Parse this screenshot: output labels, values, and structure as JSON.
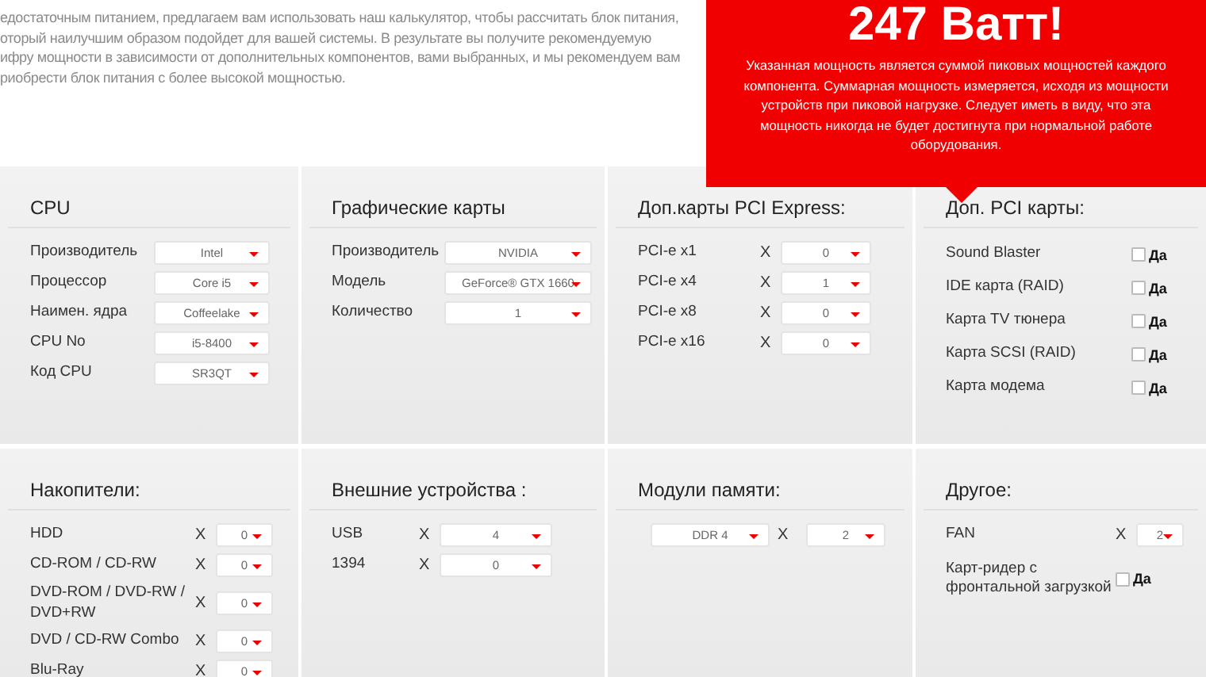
{
  "intro": {
    "lines": [
      "едостаточным питанием, предлагаем вам использовать наш калькулятор, чтобы рассчитать блок питания,",
      "оторый наилучшим образом подойдет для вашей системы. В результате вы получите рекомендуемую",
      "ифру мощности в зависимости от дополнительных компонентов, вами выбранных, и мы рекомендуем вам",
      "риобрести блок питания с более высокой мощностью."
    ]
  },
  "result": {
    "title": "247 Ватт!",
    "text": "Указанная мощность является суммой пиковых мощностей каждого компонента. Суммарная мощность измеряется, исходя из мощности устройств при пиковой нагрузке. Следует иметь в виду, что эта мощность никогда не будет достигнута при нормальной работе оборудования."
  },
  "sections": [
    {
      "title": "CPU",
      "rows": [
        {
          "kind": "select",
          "label": "Производитель",
          "value": "Intel"
        },
        {
          "kind": "select",
          "label": "Процессор",
          "value": "Core i5"
        },
        {
          "kind": "select",
          "label": "Наимен. ядра",
          "value": "Coffeelake"
        },
        {
          "kind": "select",
          "label": "CPU No",
          "value": "i5-8400"
        },
        {
          "kind": "select",
          "label": "Код CPU",
          "value": "SR3QT"
        }
      ]
    },
    {
      "title": "Графические карты",
      "rows": [
        {
          "kind": "select",
          "label": "Производитель",
          "value": "NVIDIA"
        },
        {
          "kind": "select",
          "label": "Модель",
          "value": "GeForce® GTX 1660"
        },
        {
          "kind": "select",
          "label": "Количество",
          "value": "1"
        }
      ]
    },
    {
      "title": "Доп.карты PCI Express:",
      "rows": [
        {
          "kind": "count",
          "label": "PCI-e x1",
          "times": "X",
          "value": "0"
        },
        {
          "kind": "count",
          "label": "PCI-e x4",
          "times": "X",
          "value": "1"
        },
        {
          "kind": "count",
          "label": "PCI-e x8",
          "times": "X",
          "value": "0"
        },
        {
          "kind": "count",
          "label": "PCI-e x16",
          "times": "X",
          "value": "0"
        }
      ]
    },
    {
      "title": "Доп. PCI карты:",
      "rows": [
        {
          "kind": "check",
          "label": "Sound Blaster",
          "option": "Да",
          "checked": false
        },
        {
          "kind": "check",
          "label": "IDE карта (RAID)",
          "option": "Да",
          "checked": false
        },
        {
          "kind": "check",
          "label": "Карта TV тюнера",
          "option": "Да",
          "checked": false
        },
        {
          "kind": "check",
          "label": "Карта SCSI (RAID)",
          "option": "Да",
          "checked": false
        },
        {
          "kind": "check",
          "label": "Карта модема",
          "option": "Да",
          "checked": false
        }
      ]
    },
    {
      "title": "Накопители:",
      "rows": [
        {
          "kind": "count",
          "label": "HDD",
          "times": "X",
          "value": "0"
        },
        {
          "kind": "count",
          "label": "CD-ROM / CD-RW",
          "times": "X",
          "value": "0"
        },
        {
          "kind": "count",
          "label": "DVD-ROM / DVD-RW / DVD+RW",
          "times": "X",
          "value": "0"
        },
        {
          "kind": "count",
          "label": "DVD / CD-RW Combo",
          "times": "X",
          "value": "0"
        },
        {
          "kind": "count",
          "label": "Blu-Ray",
          "times": "X",
          "value": "0"
        }
      ]
    },
    {
      "title": "Внешние устройства :",
      "rows": [
        {
          "kind": "count",
          "label": "USB",
          "times": "X",
          "value": "4"
        },
        {
          "kind": "count",
          "label": "1394",
          "times": "X",
          "value": "0"
        }
      ]
    },
    {
      "title": "Модули памяти:",
      "rows": [
        {
          "kind": "pair",
          "value": "DDR 4",
          "times": "X",
          "count": "2"
        }
      ]
    },
    {
      "title": "Другое:",
      "rows": [
        {
          "kind": "count",
          "label": "FAN",
          "times": "X",
          "value": "2"
        },
        {
          "kind": "check",
          "label": "Карт-ридер с фронтальной загрузкой",
          "option": "Да",
          "checked": false
        }
      ]
    }
  ]
}
